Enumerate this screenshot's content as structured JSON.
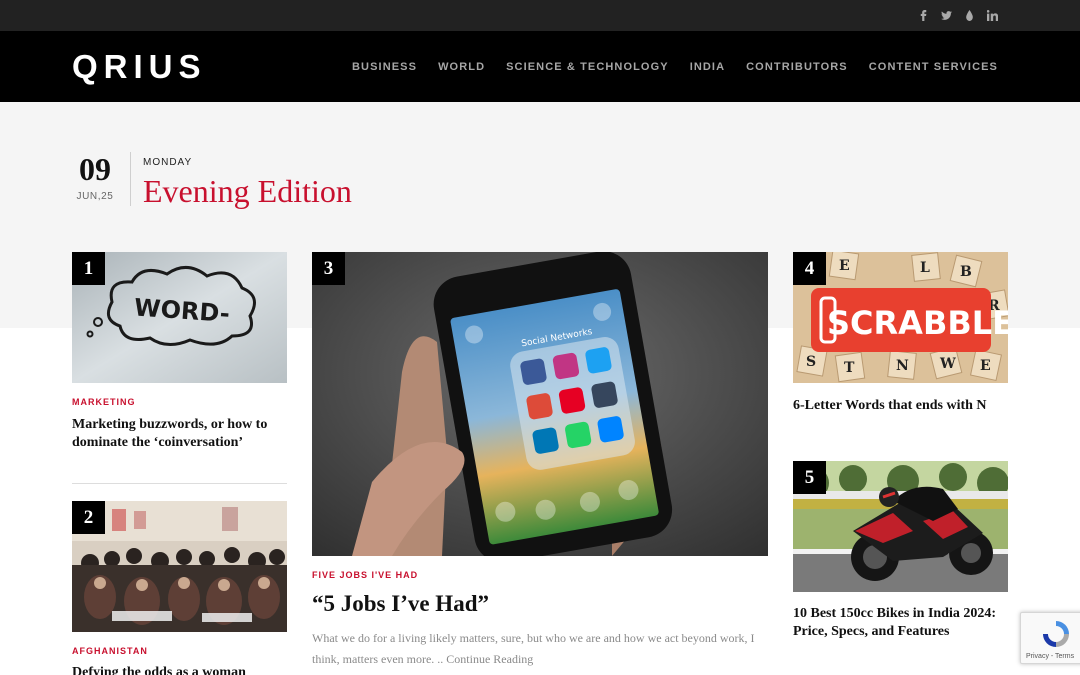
{
  "social": {
    "icons": [
      "facebook-icon",
      "twitter-icon",
      "instagram-icon",
      "linkedin-icon"
    ]
  },
  "header": {
    "logo": "QRIUS",
    "nav": [
      "BUSINESS",
      "WORLD",
      "SCIENCE & TECHNOLOGY",
      "INDIA",
      "CONTRIBUTORS",
      "CONTENT SERVICES"
    ]
  },
  "edition": {
    "day": "09",
    "month_year": "JUN,25",
    "weekday": "MONDAY",
    "title": "Evening Edition"
  },
  "articles": [
    {
      "num": "1",
      "category": "MARKETING",
      "title": "Marketing buzzwords, or how to dominate the ‘coinversation’",
      "image": "word-doodle-image"
    },
    {
      "num": "2",
      "category": "AFGHANISTAN",
      "title": "Defying the odds as a woman",
      "image": "classroom-image"
    },
    {
      "num": "3",
      "category": "FIVE JOBS I'VE HAD",
      "title": "“5 Jobs I’ve Had”",
      "excerpt": "What we do for a living likely matters, sure, but who we are and how we act beyond work, I think, matters even more. .. ",
      "more": "Continue Reading",
      "image": "smartphone-social-image"
    },
    {
      "num": "4",
      "title": "6-Letter Words that ends with N",
      "image": "scrabble-image",
      "image_text": "SCRABBLE"
    },
    {
      "num": "5",
      "title": "10 Best 150cc Bikes in India 2024: Price, Specs, and Features",
      "image": "motorbike-image"
    }
  ],
  "phone_screen": {
    "folder_label": "Social Networks"
  },
  "recaptcha": {
    "text": "Privacy - Terms"
  },
  "colors": {
    "accent": "#c8102e",
    "header_bg": "#000000",
    "topbar_bg": "#222222",
    "band_bg": "#f5f5f5"
  }
}
